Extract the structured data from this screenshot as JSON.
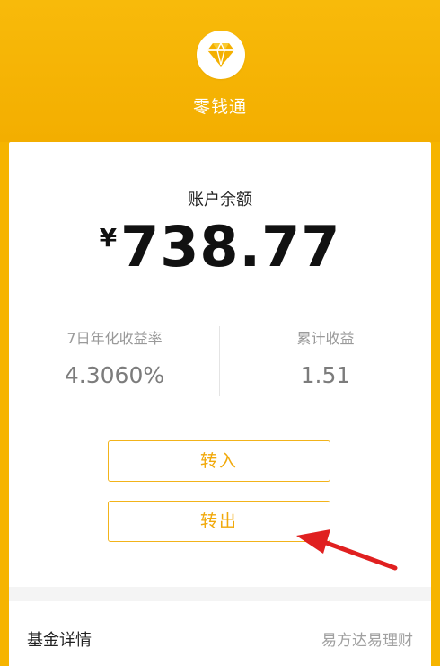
{
  "header": {
    "icon": "diamond-icon",
    "title": "零钱通"
  },
  "balance": {
    "label": "账户余额",
    "currency": "¥",
    "amount": "738.77"
  },
  "stats": {
    "yield_label": "7日年化收益率",
    "yield_value": "4.3060%",
    "earnings_label": "累计收益",
    "earnings_value": "1.51"
  },
  "buttons": {
    "transfer_in": "转入",
    "transfer_out": "转出"
  },
  "footer": {
    "fund_details": "基金详情",
    "provider": "易方达易理财"
  },
  "annotation": {
    "icon": "red-arrow-icon",
    "color": "#E02020"
  },
  "colors": {
    "brand_yellow": "#F6B400",
    "button_text": "#F1A90B"
  }
}
